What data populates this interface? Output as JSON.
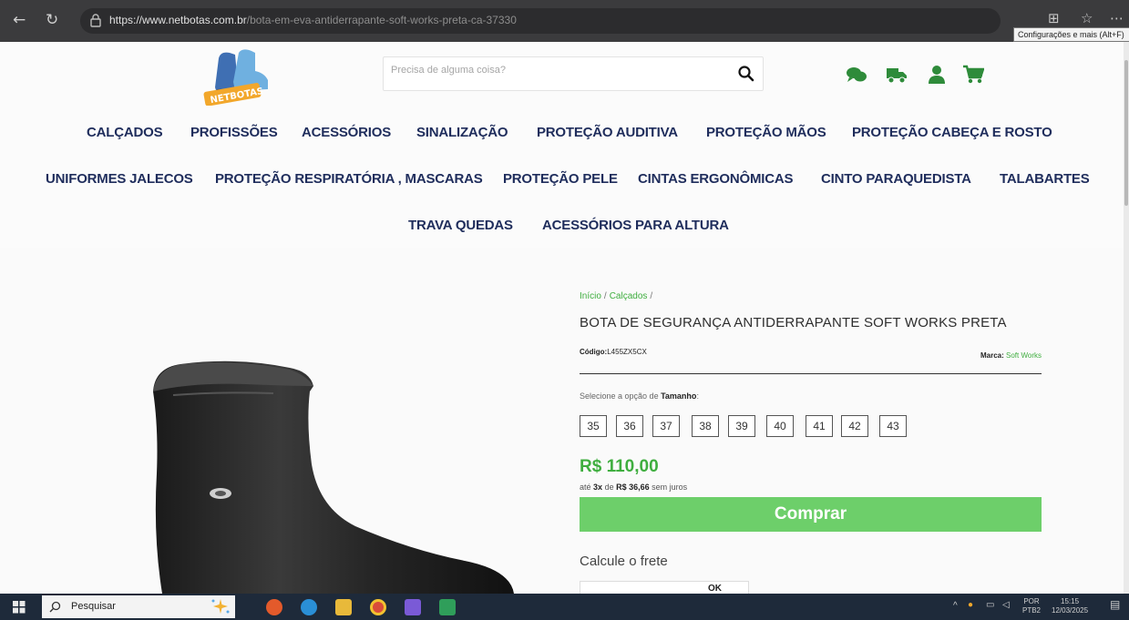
{
  "browser": {
    "url_host": "https://www.netbotas.com.br",
    "url_path": "/bota-em-eva-antiderrapante-soft-works-preta-ca-37330",
    "tooltip": "Configurações e mais (Alt+F)"
  },
  "header": {
    "logo_text": "NETBOTAS",
    "search_placeholder": "Precisa de alguma coisa?",
    "icons": [
      "chat-icon",
      "truck-icon",
      "user-icon",
      "cart-icon"
    ]
  },
  "categories": {
    "row1": [
      "CALÇADOS",
      "PROFISSÕES",
      "ACESSÓRIOS",
      "SINALIZAÇÃO",
      "PROTEÇÃO AUDITIVA",
      "PROTEÇÃO MÃOS",
      "PROTEÇÃO CABEÇA E ROSTO"
    ],
    "row2": [
      "UNIFORMES JALECOS",
      "PROTEÇÃO RESPIRATÓRIA , MASCARAS",
      "PROTEÇÃO PELE",
      "CINTAS ERGONÔMICAS",
      "CINTO PARAQUEDISTA",
      "TALABARTES"
    ],
    "row3": [
      "TRAVA QUEDAS",
      "ACESSÓRIOS PARA ALTURA"
    ]
  },
  "product": {
    "breadcrumb": [
      "Início",
      "Calçados"
    ],
    "title": "BOTA DE SEGURANÇA ANTIDERRAPANTE SOFT WORKS PRETA",
    "code_label": "Código:",
    "code": "L455ZX5CX",
    "brand_label": "Marca:",
    "brand": "Soft Works",
    "size_prompt": "Selecione a opção de",
    "size_prompt_bold": "Tamanho",
    "sizes": [
      "35",
      "36",
      "37",
      "38",
      "39",
      "40",
      "41",
      "42",
      "43"
    ],
    "price": "R$ 110,00",
    "inst_prefix": "até",
    "inst_count": "3x",
    "inst_mid": "de",
    "inst_value": "R$ 36,66",
    "inst_suffix": "sem juros",
    "buy_label": "Comprar",
    "shipping_title": "Calcule o frete",
    "ok_label": "OK"
  },
  "colors": {
    "accent_green": "#3fae3f",
    "buy_green": "#6dcf6a",
    "nav_blue": "#1f2d5c"
  },
  "taskbar": {
    "search_label": "Pesquisar",
    "lang": "POR",
    "lang2": "PTB2",
    "time": "15:15",
    "date": "12/03/2025"
  }
}
